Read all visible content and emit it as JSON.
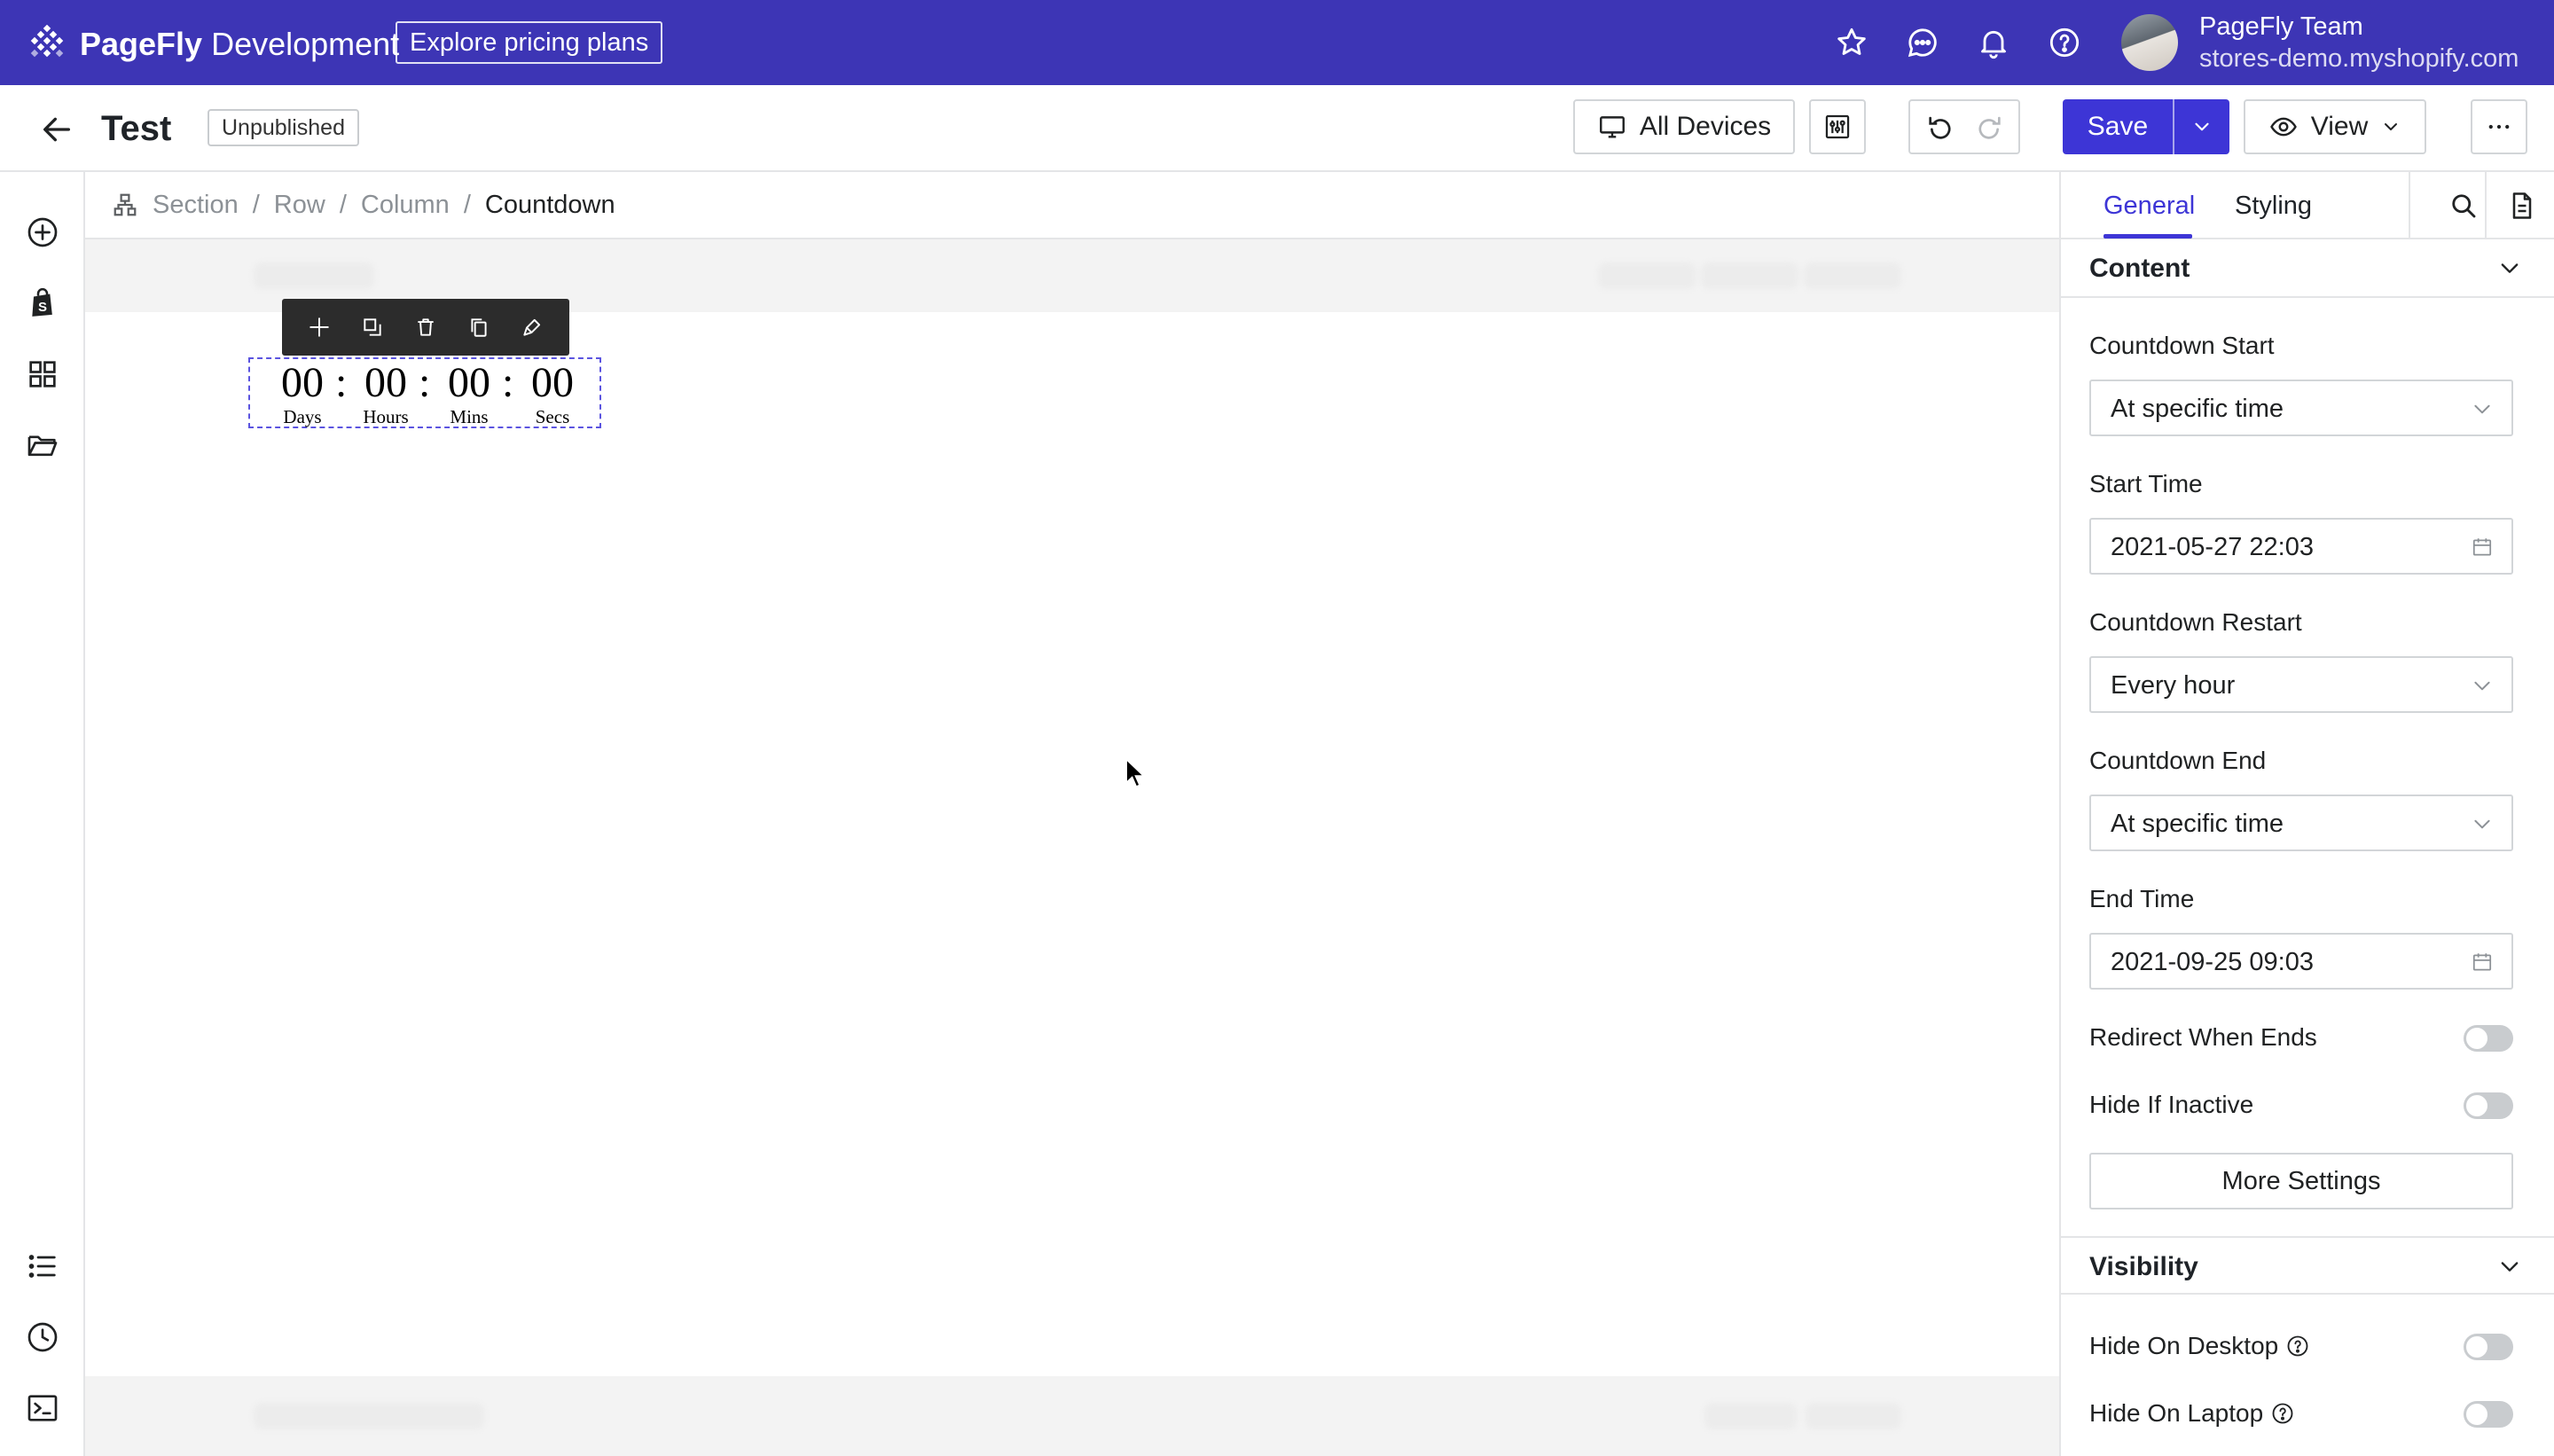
{
  "topbar": {
    "brand_bold": "PageFly",
    "brand_rest": " Development",
    "pricing_button": "Explore pricing plans",
    "user_name": "PageFly Team",
    "user_store": "stores-demo.myshopify.com",
    "icons": [
      "star-icon",
      "chat-icon",
      "bell-icon",
      "help-icon"
    ]
  },
  "toolbar": {
    "page_title": "Test",
    "status": "Unpublished",
    "device_label": "All Devices",
    "save_label": "Save",
    "view_label": "View"
  },
  "breadcrumb": [
    "Section",
    "Row",
    "Column",
    "Countdown"
  ],
  "countdown": {
    "units": [
      {
        "value": "00",
        "label": "Days"
      },
      {
        "value": "00",
        "label": "Hours"
      },
      {
        "value": "00",
        "label": "Mins"
      },
      {
        "value": "00",
        "label": "Secs"
      }
    ],
    "separator": ":"
  },
  "panel": {
    "tabs": [
      "General",
      "Styling"
    ],
    "active_tab": "General",
    "content_title": "Content",
    "fields": {
      "countdown_start_label": "Countdown Start",
      "countdown_start_value": "At specific time",
      "start_time_label": "Start Time",
      "start_time_value": "2021-05-27 22:03",
      "countdown_restart_label": "Countdown Restart",
      "countdown_restart_value": "Every hour",
      "countdown_end_label": "Countdown End",
      "countdown_end_value": "At specific time",
      "end_time_label": "End Time",
      "end_time_value": "2021-09-25 09:03",
      "redirect_label": "Redirect When Ends",
      "redirect_on": false,
      "hide_inactive_label": "Hide If Inactive",
      "hide_inactive_on": false
    },
    "more_settings": "More Settings",
    "visibility_title": "Visibility",
    "hide_desktop_label": "Hide On Desktop",
    "hide_desktop_on": false,
    "hide_laptop_label": "Hide On Laptop",
    "hide_laptop_on": false
  },
  "colors": {
    "brand": "#3d35b5",
    "accent": "#3d35d6",
    "border": "#e4e5e7"
  }
}
